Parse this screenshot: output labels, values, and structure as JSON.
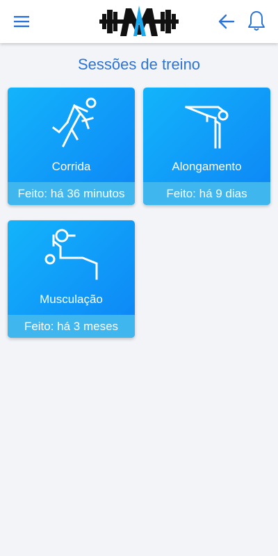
{
  "header": {
    "menu_icon": "hamburger-menu-icon",
    "logo": "dumbbell-m-logo",
    "back_icon": "arrow-left-icon",
    "notifications_icon": "bell-icon",
    "accent_color": "#2a73d9"
  },
  "page": {
    "title": "Sessões de treino"
  },
  "sessions": [
    {
      "label": "Corrida",
      "status": "Feito: há 36 minutos",
      "icon": "running-person-icon"
    },
    {
      "label": "Alongamento",
      "status": "Feito: há 9 dias",
      "icon": "stretching-person-icon"
    },
    {
      "label": "Musculação",
      "status": "Feito: há 3 meses",
      "icon": "weightlifting-icon"
    }
  ],
  "colors": {
    "card_gradient_start": "#13b4fb",
    "card_gradient_end": "#0d84f6",
    "card_footer": "#40b6ef",
    "background": "#f2f4f8"
  }
}
